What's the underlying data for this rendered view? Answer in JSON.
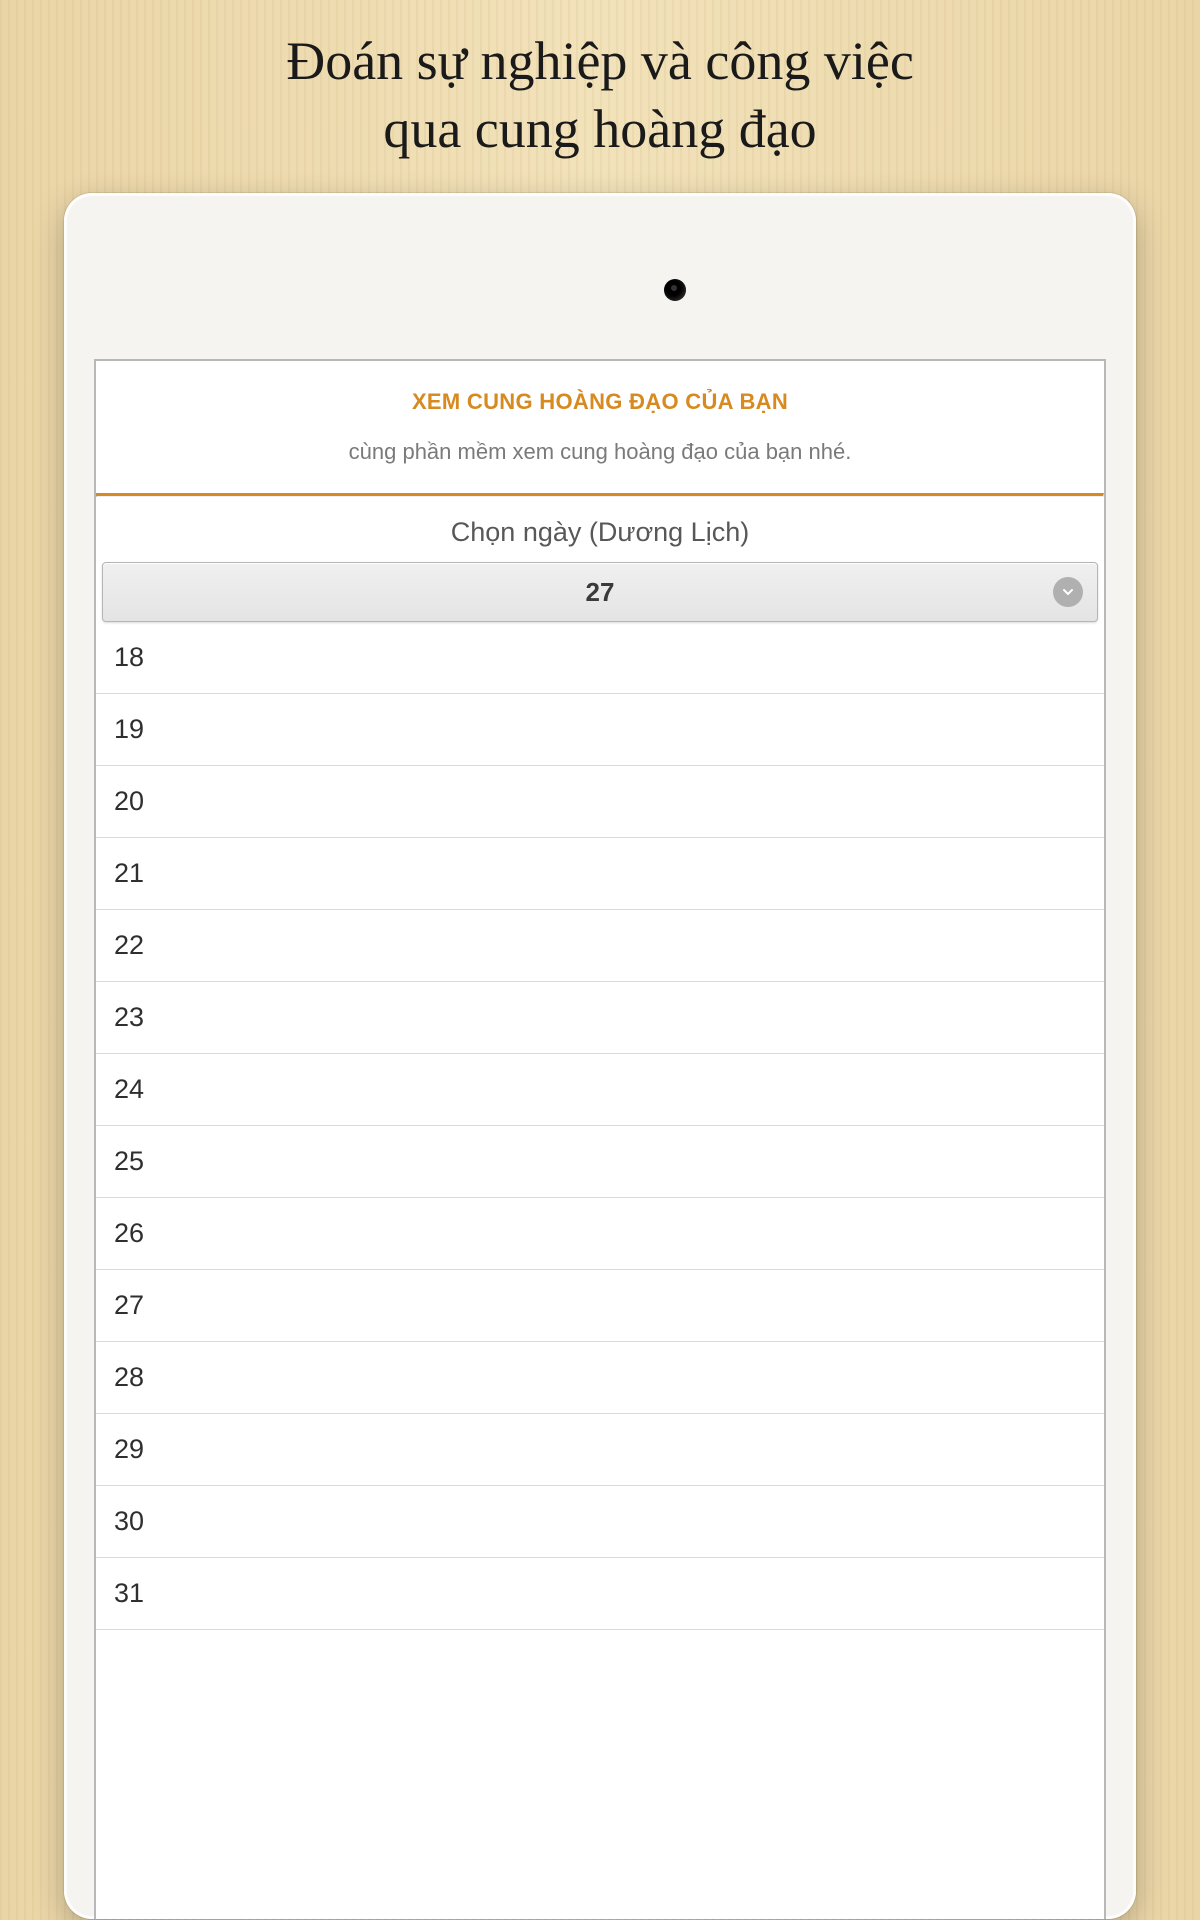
{
  "page": {
    "title_line1": "Đoán sự nghiệp và công việc",
    "title_line2": "qua cung hoàng đạo"
  },
  "app": {
    "heading": "XEM CUNG HOÀNG ĐẠO CỦA BẠN",
    "subtitle": "cùng phần mềm xem cung hoàng đạo của bạn nhé.",
    "field_label": "Chọn ngày (Dương Lịch)",
    "selected_value": "27",
    "options": [
      "18",
      "19",
      "20",
      "21",
      "22",
      "23",
      "24",
      "25",
      "26",
      "27",
      "28",
      "29",
      "30",
      "31"
    ]
  }
}
